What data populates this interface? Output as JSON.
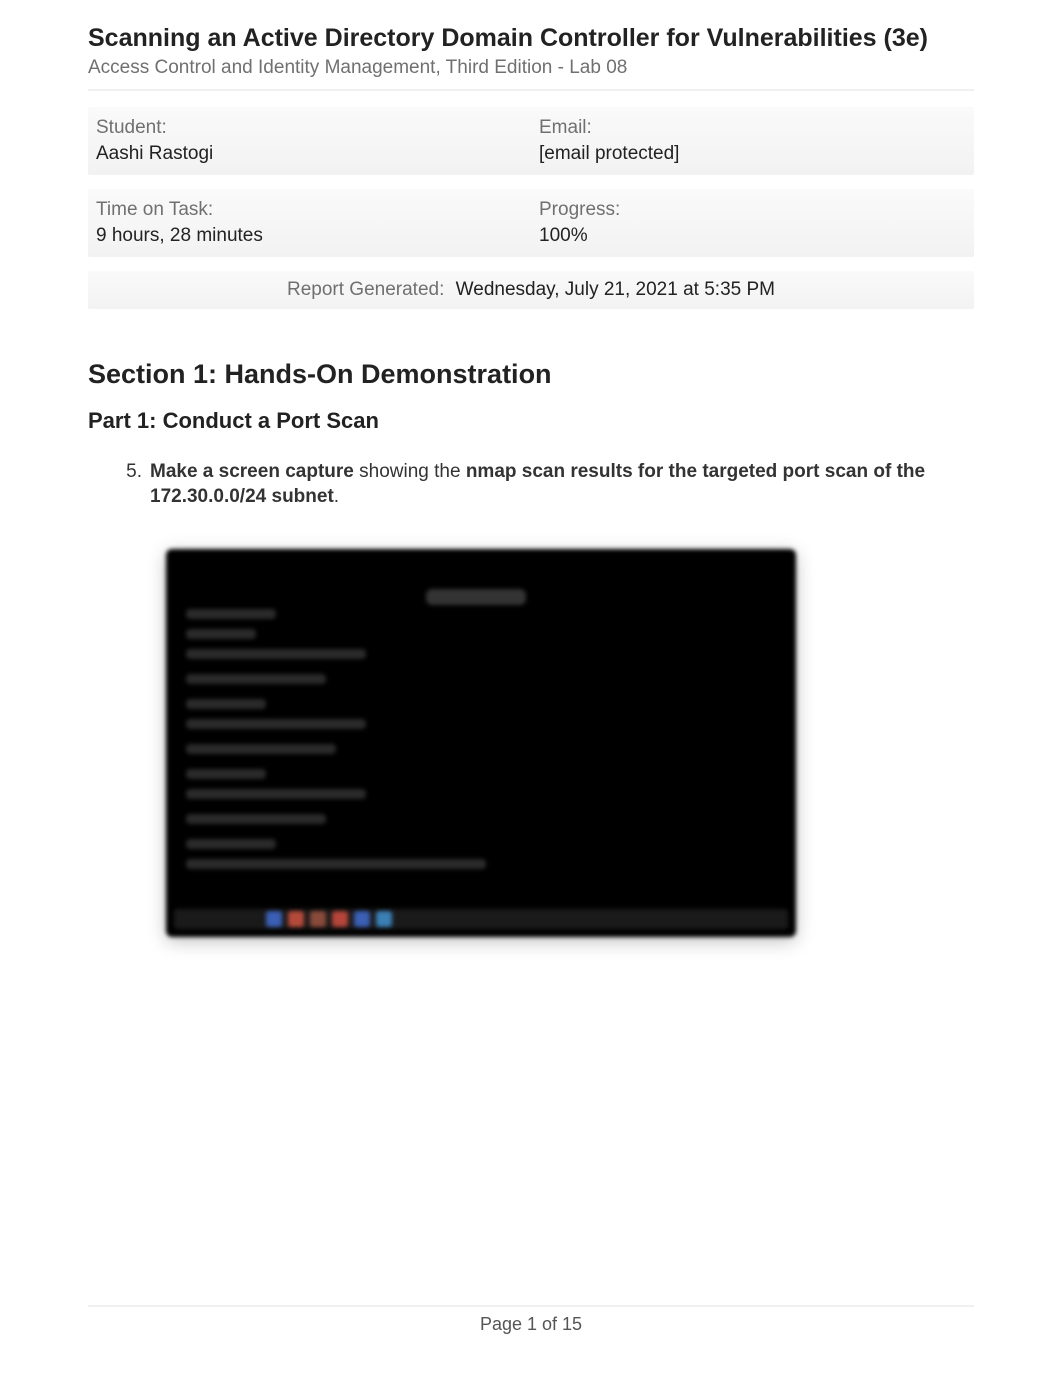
{
  "header": {
    "title": "Scanning an Active Directory Domain Controller for Vulnerabilities (3e)",
    "subtitle": "Access Control and Identity Management, Third Edition - Lab 08"
  },
  "info": {
    "student_label": "Student:",
    "student_value": "Aashi Rastogi",
    "email_label": "Email:",
    "email_value": "[email protected]",
    "time_label": "Time on Task:",
    "time_value": "9 hours, 28 minutes",
    "progress_label": "Progress:",
    "progress_value": "100%"
  },
  "report": {
    "label": "Report Generated:",
    "value": "Wednesday, July 21, 2021 at 5:35 PM"
  },
  "section": {
    "title": "Section 1: Hands-On Demonstration",
    "part_title": "Part 1: Conduct a Port Scan",
    "step_number": "5.",
    "step_bold1": "Make a screen capture",
    "step_mid": " showing the ",
    "step_bold2": "nmap scan results for the targeted port scan of the 172.30.0.0/24 subnet",
    "step_end": "."
  },
  "footer": {
    "page": "Page 1 of 15"
  }
}
